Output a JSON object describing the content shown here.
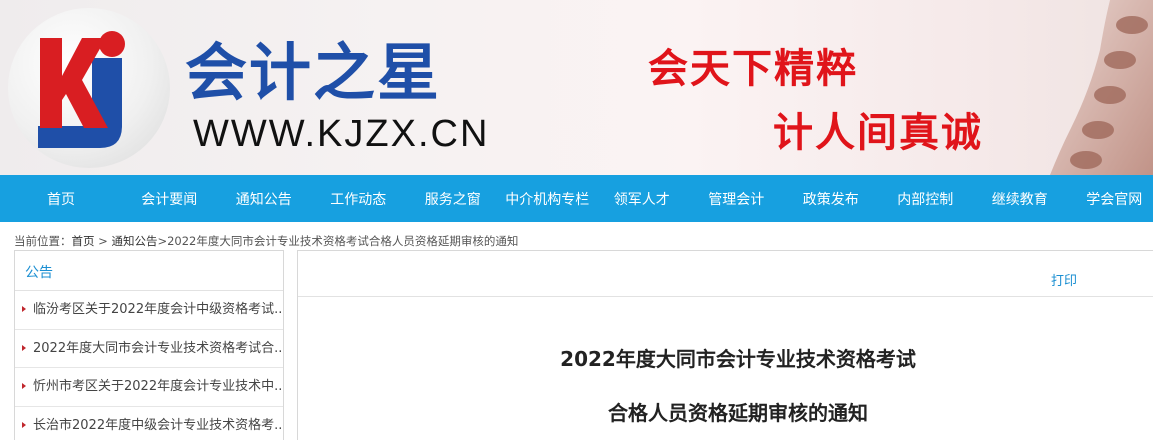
{
  "header": {
    "logo_text": "Kj",
    "site_name": "会计之星",
    "site_url": "WWW.KJZX.CN",
    "slogan_line1": "会天下精粹",
    "slogan_line2": "计人间真诚"
  },
  "nav": {
    "items": [
      "首页",
      "会计要闻",
      "通知公告",
      "工作动态",
      "服务之窗",
      "中介机构专栏",
      "领军人才",
      "管理会计",
      "政策发布",
      "内部控制",
      "继续教育",
      "学会官网"
    ]
  },
  "breadcrumb": {
    "prefix": "当前位置：",
    "home": "首页",
    "sep1": " > ",
    "section": "通知公告",
    "sep2": ">",
    "current": "2022年度大同市会计专业技术资格考试合格人员资格延期审核的通知"
  },
  "sidebar": {
    "title": "公告",
    "items": [
      "临汾考区关于2022年度会计中级资格考试...",
      "2022年度大同市会计专业技术资格考试合...",
      "忻州市考区关于2022年度会计专业技术中...",
      "长治市2022年度中级会计专业技术资格考..."
    ]
  },
  "article": {
    "print_label": "打印",
    "title_line1": "2022年度大同市会计专业技术资格考试",
    "title_line2": "合格人员资格延期审核的通知"
  },
  "colors": {
    "nav_bg": "#17a0e0",
    "brand_blue": "#1f4fa8",
    "slogan_red": "#e0141a",
    "link_blue": "#1b8fd2"
  }
}
